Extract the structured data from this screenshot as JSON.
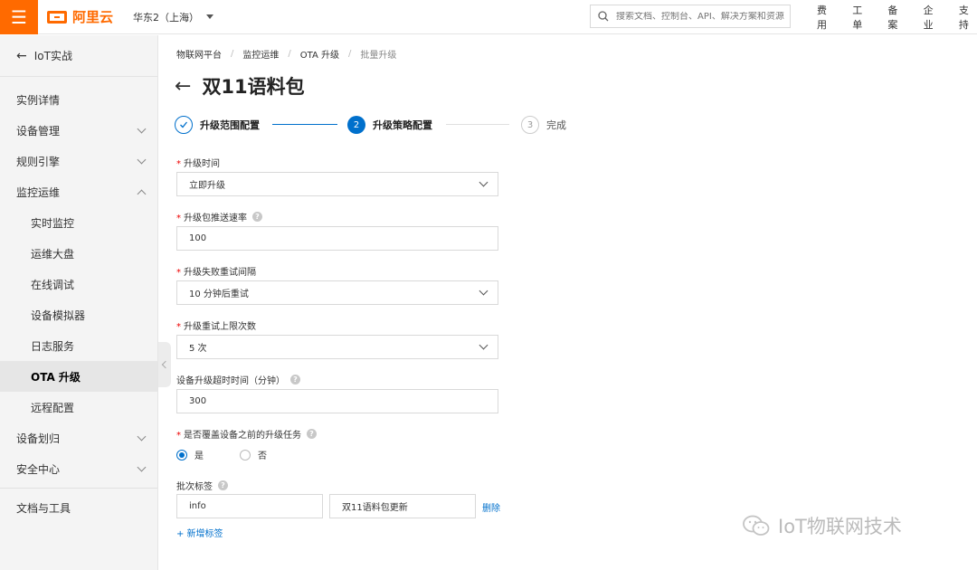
{
  "topbar": {
    "brand": "阿里云",
    "region": "华东2（上海）",
    "search_placeholder": "搜索文档、控制台、API、解决方案和资源",
    "links": [
      "费用",
      "工单",
      "备案",
      "企业",
      "支持"
    ]
  },
  "sidebar": {
    "back_label": "IoT实战",
    "items": [
      {
        "label": "实例详情"
      },
      {
        "label": "设备管理"
      },
      {
        "label": "规则引擎"
      },
      {
        "label": "监控运维"
      }
    ],
    "sub_items": [
      "实时监控",
      "运维大盘",
      "在线调试",
      "设备模拟器",
      "日志服务",
      "OTA 升级",
      "远程配置"
    ],
    "items_after": [
      {
        "label": "设备划归"
      },
      {
        "label": "安全中心"
      }
    ],
    "footer_item": "文档与工具"
  },
  "breadcrumb": [
    "物联网平台",
    "监控运维",
    "OTA 升级",
    "批量升级"
  ],
  "page_title": "双11语料包",
  "steps": [
    {
      "number": "1",
      "label": "升级范围配置",
      "state": "done"
    },
    {
      "number": "2",
      "label": "升级策略配置",
      "state": "active"
    },
    {
      "number": "3",
      "label": "完成",
      "state": "pending"
    }
  ],
  "form": {
    "upgrade_time_label": "升级时间",
    "upgrade_time_value": "立即升级",
    "push_rate_label": "升级包推送速率",
    "push_rate_value": "100",
    "retry_interval_label": "升级失败重试间隔",
    "retry_interval_value": "10 分钟后重试",
    "retry_limit_label": "升级重试上限次数",
    "retry_limit_value": "5 次",
    "timeout_label": "设备升级超时时间（分钟）",
    "timeout_value": "300",
    "override_label": "是否覆盖设备之前的升级任务",
    "override_yes": "是",
    "override_no": "否",
    "batch_tag_label": "批次标签",
    "tag_key": "info",
    "tag_value": "双11语料包更新",
    "delete_label": "删除",
    "add_tag_label": "+ 新增标签"
  },
  "watermark": "IoT物联网技术",
  "colors": {
    "accent": "#ff6a00",
    "primary": "#0070cc"
  }
}
